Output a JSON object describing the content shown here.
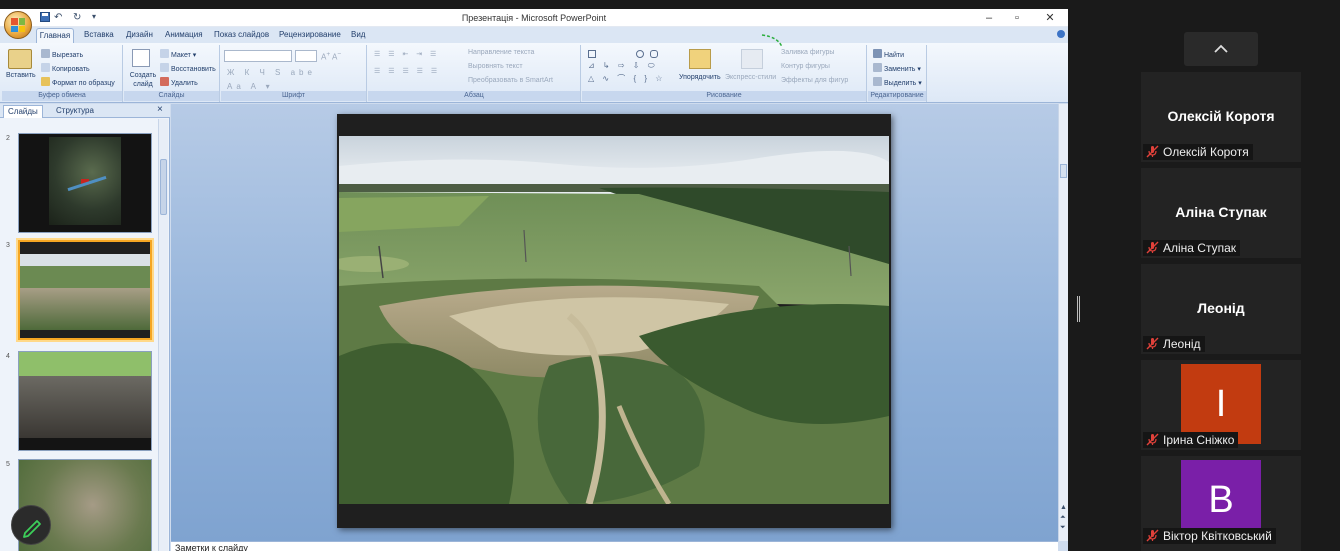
{
  "app": {
    "title": "Презентація - Microsoft PowerPoint"
  },
  "tabs": [
    "Главная",
    "Вставка",
    "Дизайн",
    "Анимация",
    "Показ слайдов",
    "Рецензирование",
    "Вид"
  ],
  "ribbon": {
    "clipboard": {
      "paste": "Вставить",
      "cut": "Вырезать",
      "copy": "Копировать",
      "format": "Формат по образцу",
      "label": "Буфер обмена"
    },
    "slides": {
      "create": "Создать слайд",
      "layout": "Макет",
      "reset": "Восстановить",
      "delete": "Удалить",
      "label": "Слайды"
    },
    "font": {
      "label": "Шрифт"
    },
    "paragraph": {
      "direction": "Направление текста",
      "align": "Выровнять текст",
      "smartart": "Преобразовать в SmartArt",
      "label": "Абзац"
    },
    "drawing": {
      "arrange": "Упорядочить",
      "styles": "Экспресс-стили",
      "fill": "Заливка фигуры",
      "outline": "Контур фигуры",
      "effects": "Эффекты для фигур",
      "label": "Рисование"
    },
    "editing": {
      "find": "Найти",
      "replace": "Заменить",
      "select": "Выделить",
      "label": "Редактирование"
    }
  },
  "panel": {
    "tab_slides": "Слайды",
    "tab_outline": "Структура",
    "close": "×",
    "thumbs": [
      {
        "num": "2"
      },
      {
        "num": "3"
      },
      {
        "num": "4"
      },
      {
        "num": "5"
      }
    ]
  },
  "notes": {
    "placeholder": "Заметки к слайду"
  },
  "participants": [
    {
      "display": "Олексій Коротя",
      "name": "Олексій Коротя"
    },
    {
      "display": "Аліна Ступак",
      "name": "Аліна Ступак"
    },
    {
      "display": "Леонід",
      "name": "Леонід"
    },
    {
      "display": "І",
      "name": "Ірина Сніжко",
      "avatar_color": "#c23b10"
    },
    {
      "display": "В",
      "name": "Віктор Квітковський",
      "avatar_color": "#7a1fa8"
    }
  ],
  "colors": {
    "muted_mic": "#e0413a"
  }
}
